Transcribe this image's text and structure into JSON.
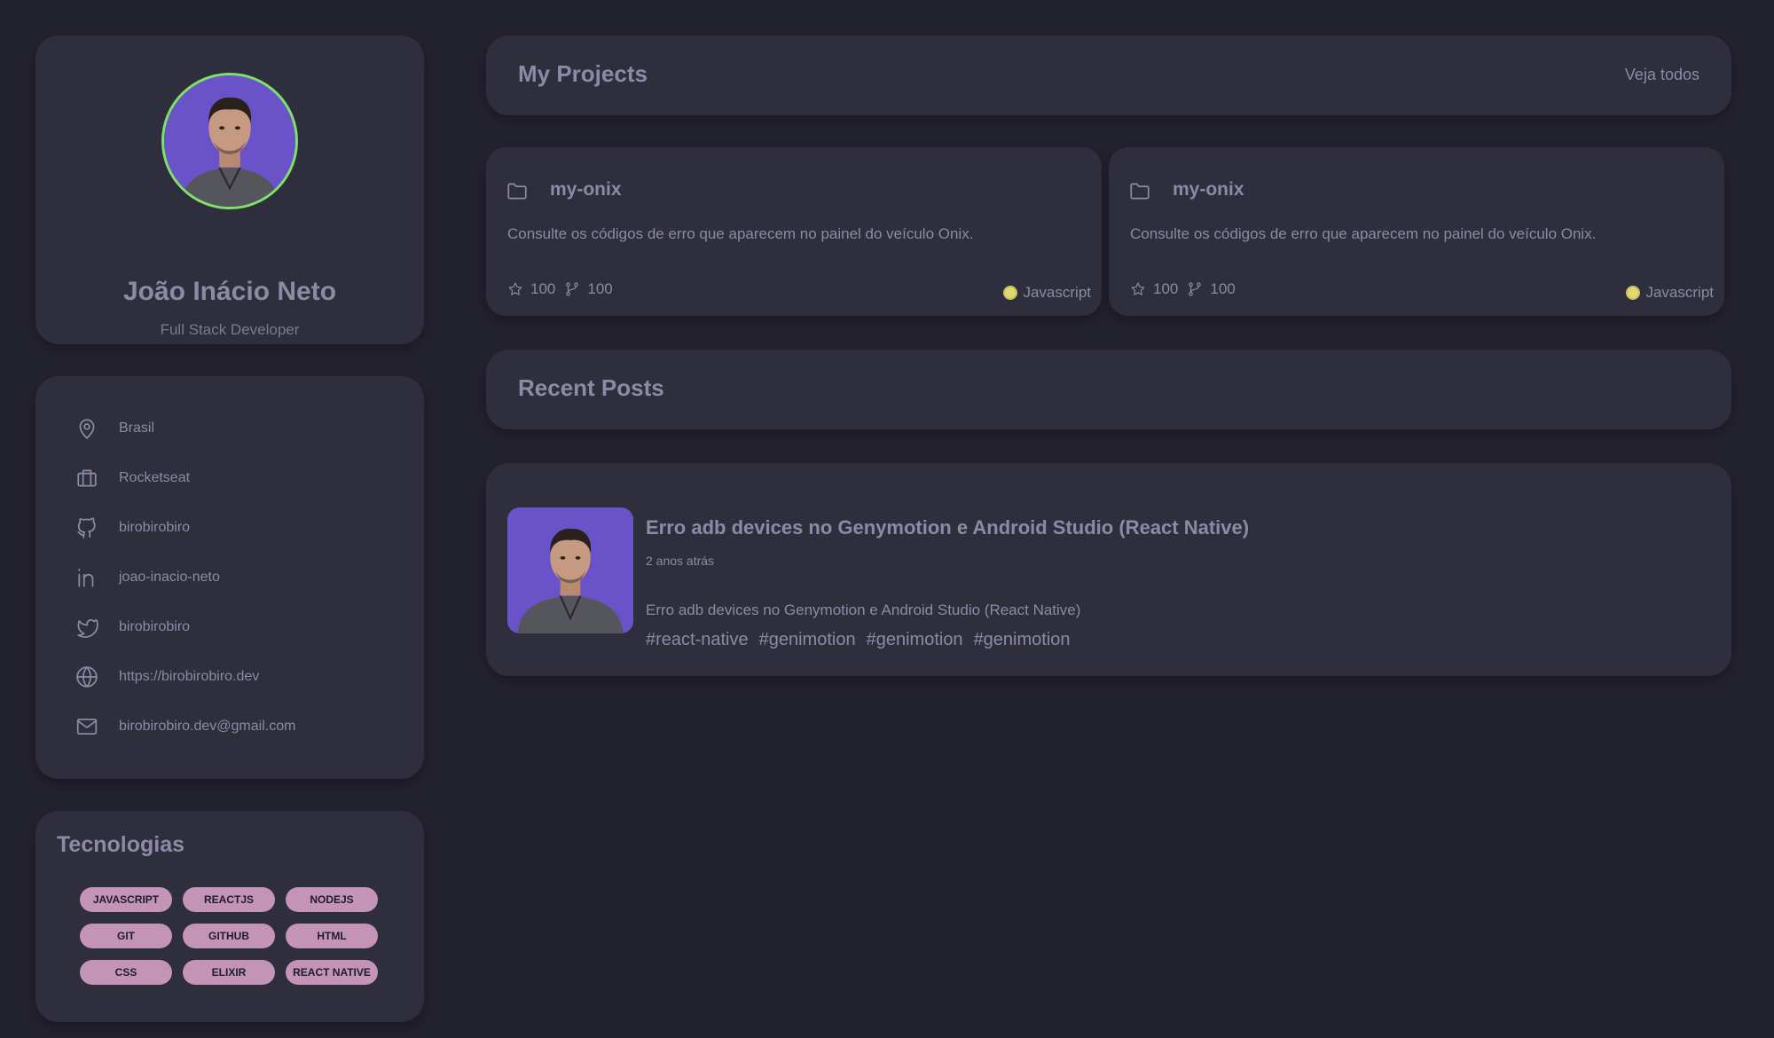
{
  "profile": {
    "name": "João Inácio Neto",
    "role": "Full Stack Developer",
    "avatar_ring_color": "#7fe06a",
    "avatar_bg_color": "#6a52c8"
  },
  "info": {
    "items": [
      {
        "icon": "map-pin-icon",
        "text": "Brasil"
      },
      {
        "icon": "briefcase-icon",
        "text": "Rocketseat"
      },
      {
        "icon": "github-icon",
        "text": "birobirobiro"
      },
      {
        "icon": "linkedin-icon",
        "text": "joao-inacio-neto"
      },
      {
        "icon": "twitter-icon",
        "text": "birobirobiro"
      },
      {
        "icon": "globe-icon",
        "text": "https://birobirobiro.dev"
      },
      {
        "icon": "mail-icon",
        "text": "birobirobiro.dev@gmail.com"
      }
    ]
  },
  "tech": {
    "title": "Tecnologias",
    "items": [
      "javascript",
      "reactjs",
      "nodejs",
      "git",
      "github",
      "html",
      "css",
      "elixir",
      "react native"
    ],
    "pill_color": "#c493b8"
  },
  "projects": {
    "title": "My Projects",
    "see_all": "Veja todos",
    "items": [
      {
        "name": "my-onix",
        "description": "Consulte os códigos de erro que aparecem no painel do veículo Onix.",
        "stars": "100",
        "forks": "100",
        "language": "Javascript",
        "language_color": "#e0d86b"
      },
      {
        "name": "my-onix",
        "description": "Consulte os códigos de erro que aparecem no painel do veículo Onix.",
        "stars": "100",
        "forks": "100",
        "language": "Javascript",
        "language_color": "#e0d86b"
      }
    ]
  },
  "posts": {
    "title": "Recent Posts",
    "items": [
      {
        "title": "Erro adb devices no Genymotion e Android Studio (React Native)",
        "time": "2 anos atrás",
        "excerpt": "Erro adb devices no Genymotion e Android Studio (React Native)",
        "tags": [
          "#react-native",
          "#genimotion",
          "#genimotion",
          "#genimotion"
        ]
      }
    ]
  },
  "colors": {
    "background": "#23222f",
    "card": "#2f2e3c",
    "text": "#8c8aa6"
  }
}
